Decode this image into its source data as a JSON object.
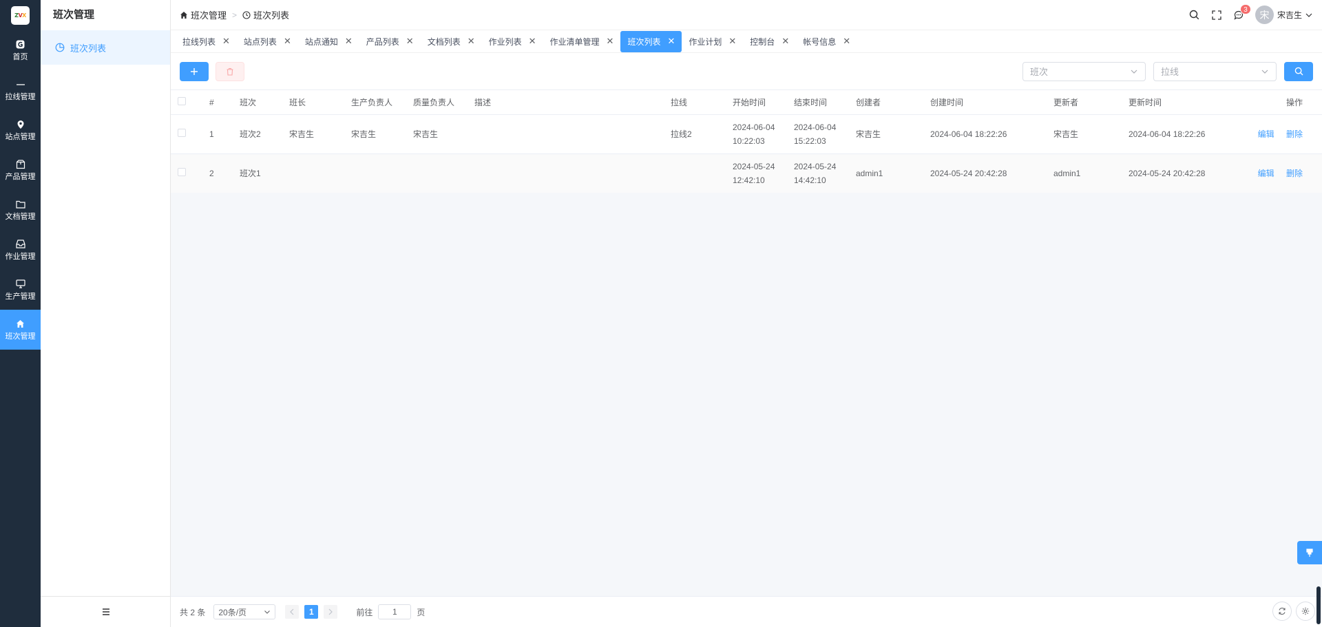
{
  "logo": {
    "text": "ZVX"
  },
  "rail": {
    "items": [
      {
        "label": "首页",
        "icon": "home-badge-icon"
      },
      {
        "label": "拉线管理",
        "icon": "line-icon"
      },
      {
        "label": "站点管理",
        "icon": "location-pin-icon"
      },
      {
        "label": "产品管理",
        "icon": "box-icon"
      },
      {
        "label": "文档管理",
        "icon": "folder-icon"
      },
      {
        "label": "作业管理",
        "icon": "inbox-icon"
      },
      {
        "label": "生产管理",
        "icon": "monitor-icon"
      },
      {
        "label": "班次管理",
        "icon": "home-icon"
      }
    ]
  },
  "submenu": {
    "title": "班次管理",
    "item": "班次列表"
  },
  "breadcrumb": {
    "root": "班次管理",
    "current": "班次列表"
  },
  "header": {
    "notification_count": "3",
    "avatar_char": "宋",
    "username": "宋吉生"
  },
  "tabs": [
    {
      "label": "拉线列表"
    },
    {
      "label": "站点列表"
    },
    {
      "label": "站点通知"
    },
    {
      "label": "产品列表"
    },
    {
      "label": "文档列表"
    },
    {
      "label": "作业列表"
    },
    {
      "label": "作业清单管理"
    },
    {
      "label": "班次列表",
      "active": true
    },
    {
      "label": "作业计划"
    },
    {
      "label": "控制台"
    },
    {
      "label": "帐号信息"
    }
  ],
  "filters": {
    "shift_placeholder": "班次",
    "line_placeholder": "拉线"
  },
  "table": {
    "columns": [
      "#",
      "班次",
      "班长",
      "生产负责人",
      "质量负责人",
      "描述",
      "拉线",
      "开始时间",
      "结束时间",
      "创建者",
      "创建时间",
      "更新者",
      "更新时间",
      "操作"
    ],
    "rows": [
      {
        "index": "1",
        "shift": "班次2",
        "leader": "宋吉生",
        "production": "宋吉生",
        "quality": "宋吉生",
        "desc": "",
        "line": "拉线2",
        "start_date": "2024-06-04",
        "start_time": "10:22:03",
        "end_date": "2024-06-04",
        "end_time": "15:22:03",
        "creator": "宋吉生",
        "created": "2024-06-04 18:22:26",
        "updater": "宋吉生",
        "updated": "2024-06-04 18:22:26",
        "edit": "编辑",
        "delete": "删除"
      },
      {
        "index": "2",
        "shift": "班次1",
        "leader": "",
        "production": "",
        "quality": "",
        "desc": "",
        "line": "",
        "start_date": "2024-05-24",
        "start_time": "12:42:10",
        "end_date": "2024-05-24",
        "end_time": "14:42:10",
        "creator": "admin1",
        "created": "2024-05-24 20:42:28",
        "updater": "admin1",
        "updated": "2024-05-24 20:42:28",
        "edit": "编辑",
        "delete": "删除"
      }
    ]
  },
  "pager": {
    "total": "共 2 条",
    "page_size": "20条/页",
    "current_page": "1",
    "goto_label": "前往",
    "goto_value": "1",
    "page_suffix": "页"
  },
  "colors": {
    "primary": "#409eff",
    "rail_bg": "#1f2d3d",
    "danger": "#f56c6c"
  }
}
